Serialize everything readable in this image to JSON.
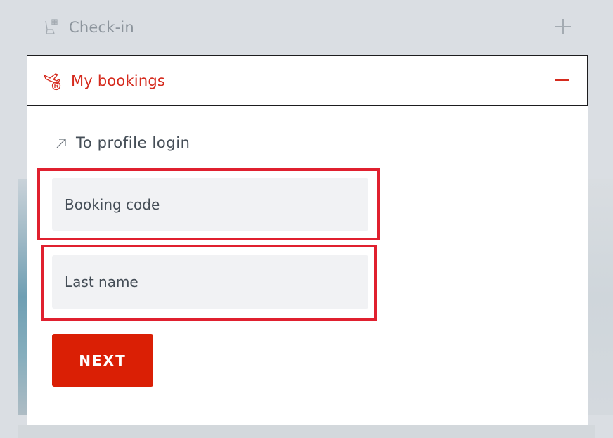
{
  "accordion": {
    "checkin": {
      "label": "Check-in",
      "icon": "seat-icon",
      "toggle_icon": "plus-icon"
    },
    "bookings": {
      "label": "My bookings",
      "icon": "plane-registered-icon",
      "toggle_icon": "minus-icon",
      "profile_link": {
        "label": "To profile login",
        "icon": "arrow-up-right-icon"
      },
      "form": {
        "booking_code": {
          "placeholder": "Booking code",
          "value": ""
        },
        "last_name": {
          "placeholder": "Last name",
          "value": ""
        },
        "submit_label": "NEXT"
      }
    }
  },
  "colors": {
    "accent": "#d52b1e",
    "button": "#da1f05",
    "highlight_outline": "#e0202f",
    "muted_text": "#8c949c",
    "body_text": "#454e57",
    "input_bg": "#f1f2f4",
    "page_bg": "#dadee3"
  }
}
